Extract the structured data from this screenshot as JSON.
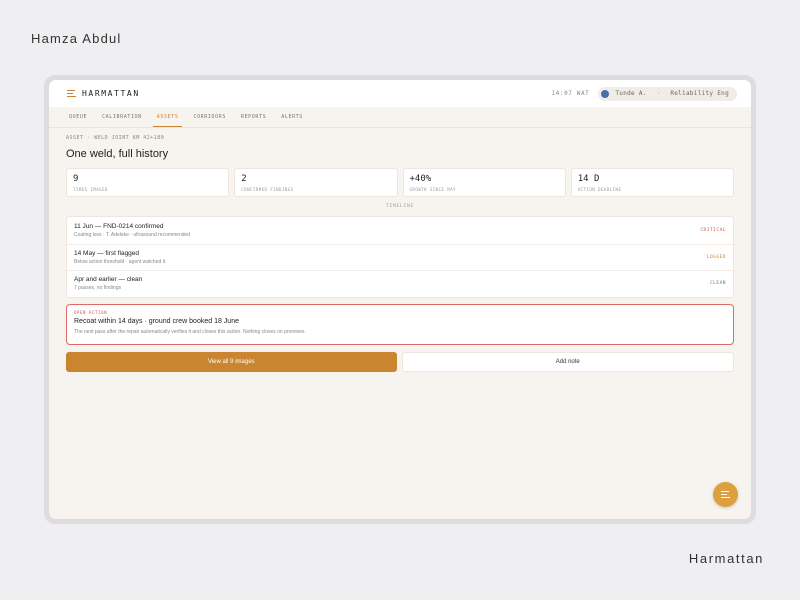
{
  "author": "Hamza Abdul",
  "brand_footer": "Harmattan",
  "header": {
    "app_name": "HARMATTAN",
    "time": "14:07 WAT",
    "user_name": "Tunde A.",
    "user_separator": "·",
    "user_role": "Reliability Eng"
  },
  "tabs": [
    {
      "label": "QUEUE"
    },
    {
      "label": "CALIBRATION"
    },
    {
      "label": "ASSETS",
      "active": true
    },
    {
      "label": "CORRIDORS"
    },
    {
      "label": "REPORTS"
    },
    {
      "label": "ALERTS"
    }
  ],
  "breadcrumb": "ASSET · WELD JOINT KM 42+180",
  "page_title": "One weld, full history",
  "stats": [
    {
      "value": "9",
      "label": "TIMES IMAGED"
    },
    {
      "value": "2",
      "label": "CONFIRMED FINDINGS"
    },
    {
      "value": "+40%",
      "label": "GROWTH SINCE MAY"
    },
    {
      "value": "14 D",
      "label": "ACTION DEADLINE"
    }
  ],
  "timeline_label": "TIMELINE",
  "timeline": [
    {
      "title": "11 Jun — FND-0214 confirmed",
      "subtitle": "Coating loss · T. Adeleke · ultrasound recommended",
      "badge": "CRITICAL"
    },
    {
      "title": "14 May — first flagged",
      "subtitle": "Below action threshold · agent watched it",
      "badge": "LOGGED"
    },
    {
      "title": "Apr and earlier — clean",
      "subtitle": "7 passes, no findings",
      "badge": "CLEAN"
    }
  ],
  "open_action": {
    "tag": "OPEN ACTION",
    "title": "Recoat within 14 days · ground crew booked 18 June",
    "subtitle": "The next pass after the repair automatically verifies it and closes this action. Nothing closes on promises."
  },
  "buttons": {
    "primary": "View all 9 images",
    "secondary": "Add note"
  },
  "colors": {
    "accent": "#c9852f",
    "critical": "#d9534f",
    "clean": "#4a8f6c",
    "screen_bg": "#f7f3ee"
  },
  "icons": {
    "logo": "menu-lines-icon",
    "user_status": "status-dot-icon",
    "fab": "menu-lines-icon"
  }
}
